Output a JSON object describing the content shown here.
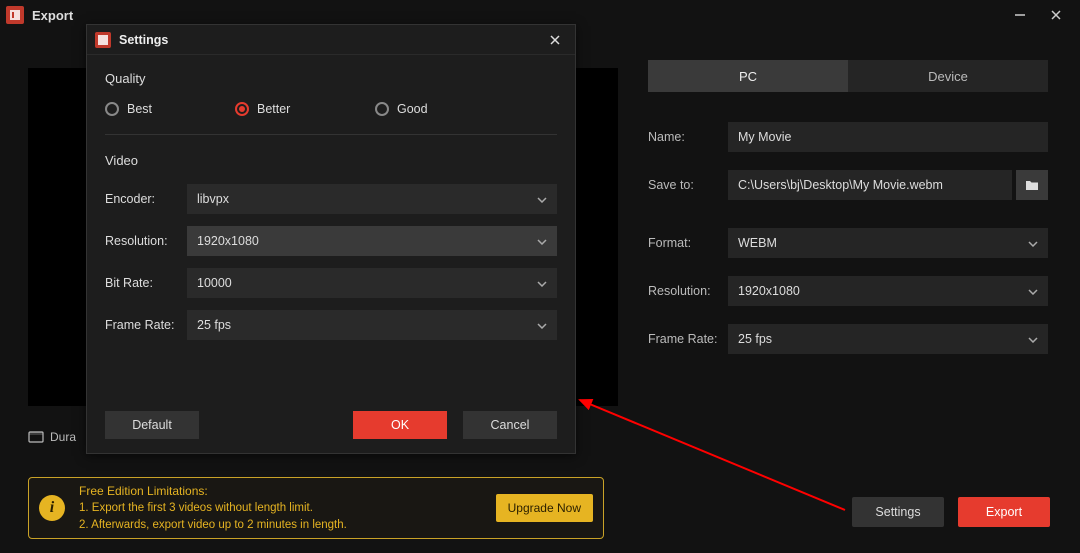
{
  "window": {
    "title": "Export"
  },
  "preview": {
    "duration_label": "Dura"
  },
  "right_panel": {
    "tabs": {
      "pc": "PC",
      "device": "Device"
    },
    "name_label": "Name:",
    "name_value": "My Movie",
    "saveto_label": "Save to:",
    "saveto_value": "C:\\Users\\bj\\Desktop\\My Movie.webm",
    "format_label": "Format:",
    "format_value": "WEBM",
    "resolution_label": "Resolution:",
    "resolution_value": "1920x1080",
    "framerate_label": "Frame Rate:",
    "framerate_value": "25 fps"
  },
  "banner": {
    "title": "Free Edition Limitations:",
    "line1": "1. Export the first 3 videos without length limit.",
    "line2": "2. Afterwards, export video up to 2 minutes in length.",
    "upgrade": "Upgrade Now"
  },
  "bottom_buttons": {
    "settings": "Settings",
    "export": "Export"
  },
  "dialog": {
    "title": "Settings",
    "quality_header": "Quality",
    "quality_options": {
      "best": "Best",
      "better": "Better",
      "good": "Good"
    },
    "video_header": "Video",
    "encoder_label": "Encoder:",
    "encoder_value": "libvpx",
    "resolution_label": "Resolution:",
    "resolution_value": "1920x1080",
    "bitrate_label": "Bit Rate:",
    "bitrate_value": "10000",
    "framerate_label": "Frame Rate:",
    "framerate_value": "25 fps",
    "default_btn": "Default",
    "ok_btn": "OK",
    "cancel_btn": "Cancel"
  }
}
